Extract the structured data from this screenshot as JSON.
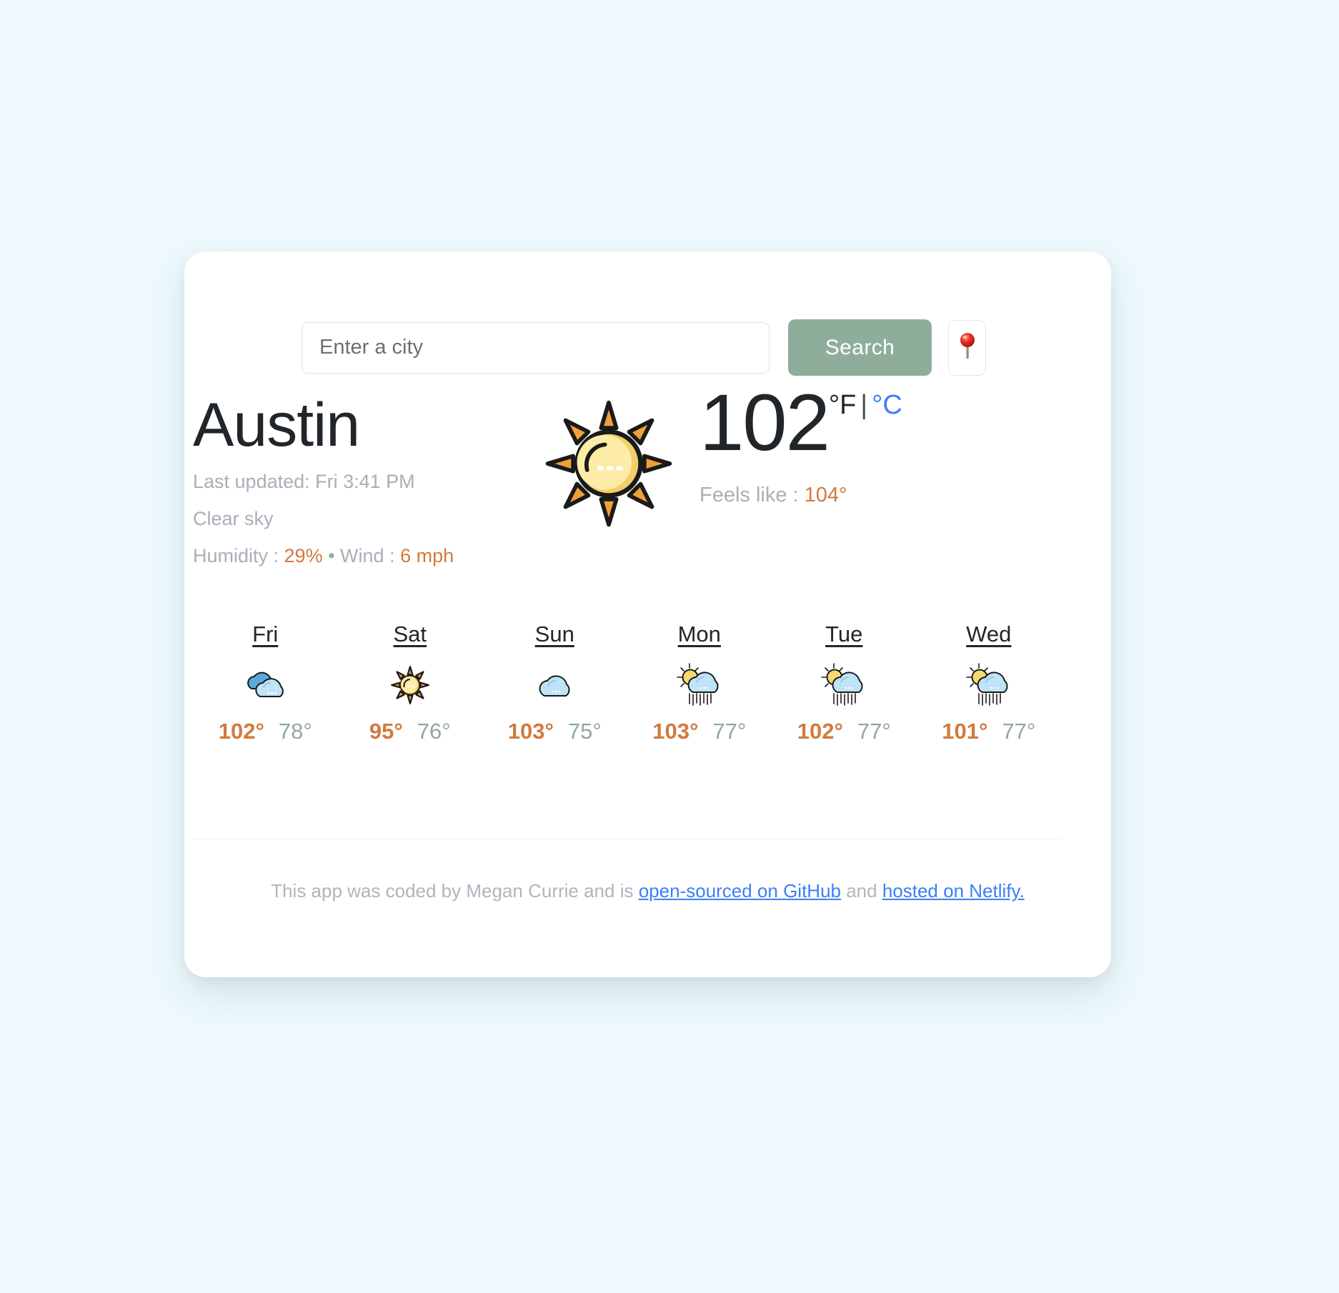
{
  "background_color": "#edf9fc",
  "search": {
    "placeholder": "Enter a city",
    "value": "",
    "search_label": "Search",
    "current_location_icon": "pushpin-icon"
  },
  "current": {
    "city": "Austin",
    "last_updated": "Last updated: Fri 3:41 PM",
    "description": "Clear sky",
    "humidity_label": "Humidity : ",
    "humidity_value": "29%",
    "separator": " • ",
    "wind_label": "Wind : ",
    "wind_value": "6 mph",
    "icon": "sun-icon",
    "temperature": "102",
    "unit_fahrenheit": "°F",
    "unit_separator": "|",
    "unit_celsius": "°C",
    "active_unit": "fahrenheit",
    "feels_like_label": "Feels like : ",
    "feels_like_value": "104°",
    "accent_hot": "#d2793f",
    "accent_link": "#3b7ff5",
    "accent_brand": "#8eae9b"
  },
  "forecast": [
    {
      "day": "Fri",
      "icon": "broken-clouds-icon",
      "max": "102°",
      "min": "78°"
    },
    {
      "day": "Sat",
      "icon": "sun-icon",
      "max": "95°",
      "min": "76°"
    },
    {
      "day": "Sun",
      "icon": "cloud-icon",
      "max": "103°",
      "min": "75°"
    },
    {
      "day": "Mon",
      "icon": "sun-rain-icon",
      "max": "103°",
      "min": "77°"
    },
    {
      "day": "Tue",
      "icon": "sun-rain-icon",
      "max": "102°",
      "min": "77°"
    },
    {
      "day": "Wed",
      "icon": "sun-rain-icon",
      "max": "101°",
      "min": "77°"
    }
  ],
  "footer": {
    "prefix": "This app was coded by Megan Currie and is ",
    "github_link": "open-sourced on GitHub",
    "middle": " and ",
    "netlify_link": "hosted on Netlify."
  }
}
